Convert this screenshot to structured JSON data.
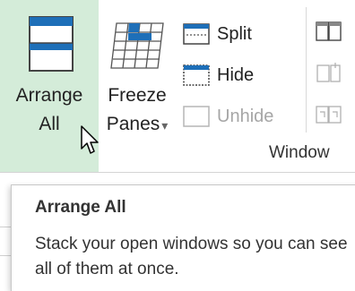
{
  "ribbon": {
    "arrange_all": {
      "line1": "Arrange",
      "line2": "All",
      "icon": "arrange-all-icon"
    },
    "freeze_panes": {
      "line1": "Freeze",
      "line2": "Panes",
      "dropdown": "▾",
      "icon": "freeze-panes-icon"
    },
    "split_label": "Split",
    "hide_label": "Hide",
    "unhide_label": "Unhide",
    "group_label": "Window",
    "colors": {
      "highlight": "#d4ecd9",
      "icon_blue": "#1e6fb8",
      "disabled_text": "#a6a6a6"
    }
  },
  "tooltip": {
    "title": "Arrange All",
    "description": "Stack your open windows so you can see all of them at once."
  }
}
